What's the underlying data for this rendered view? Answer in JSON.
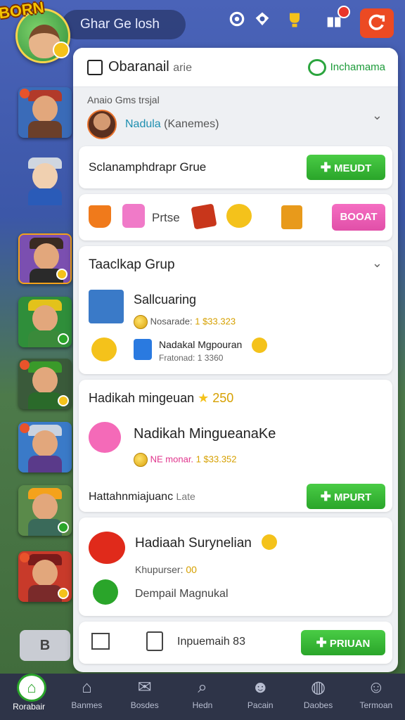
{
  "topbar": {
    "logo_text": "BORN",
    "search_text": "Ghar Ge losh",
    "icons": [
      "refresh-icon",
      "puzzle-icon",
      "trophy-icon",
      "gift-icon"
    ],
    "action_icon": "refresh-action-icon"
  },
  "panel": {
    "title": "Obaranail",
    "title_suffix": "arie",
    "status": "Inchamama",
    "account": {
      "label": "Anaio Gms trsjal",
      "name": "Nadula",
      "name_suffix": "(Kanemes)"
    },
    "group_row": {
      "label": "Sclanamphdrapr Grue",
      "button": "MEUDT"
    },
    "items_row": {
      "label": "Prtse",
      "button": "BOOAT"
    },
    "group_section": {
      "title": "Taaclkap Grup",
      "item1": {
        "title": "Sallcuaring",
        "meta_label": "Nosarade:",
        "meta_value": "1 $33.323"
      },
      "item2": {
        "title": "Nadakal Mgpouran",
        "sub_label": "Fratonad:",
        "sub_value": "1 3360"
      }
    },
    "reward_section": {
      "title": "Hadikah mingeuan",
      "star_value": "250",
      "item": {
        "title": "Nadikah MingueanaKe",
        "meta_label": "NE monar.",
        "meta_value": "1 $33.352"
      },
      "footer_label": "Hattahnmiajuanc",
      "footer_suffix": "Late",
      "footer_button": "MPURT"
    },
    "survey_section": {
      "title": "Hadiaah Surynelian",
      "sub_label": "Khupurser:",
      "sub_value": "00",
      "sub2": "Dempail Magnukal"
    },
    "footer_bar": {
      "label": "Inpuemaih",
      "label_suffix": "83",
      "button": "PRIUAN"
    }
  },
  "sidebar": {
    "toggle_label": "B"
  },
  "bottomnav": {
    "items": [
      {
        "label": "Rorabair",
        "icon": "home-icon"
      },
      {
        "label": "Banmes",
        "icon": "house-icon"
      },
      {
        "label": "Bosdes",
        "icon": "megaphone-icon"
      },
      {
        "label": "Hedn",
        "icon": "search-icon"
      },
      {
        "label": "Pacain",
        "icon": "people-icon"
      },
      {
        "label": "Daobes",
        "icon": "globe-icon"
      },
      {
        "label": "Termoan",
        "icon": "profile-icon"
      }
    ]
  },
  "colors": {
    "accent_green": "#2aa52a",
    "accent_pink": "#e14fa8",
    "accent_orange": "#ec4a23",
    "nav_bg": "#2e3448"
  }
}
